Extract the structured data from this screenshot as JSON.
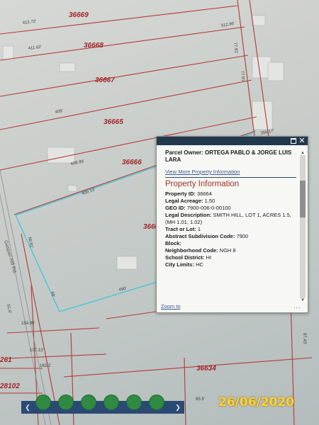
{
  "map": {
    "parcel_labels": [
      "36669",
      "36668",
      "36667",
      "36665",
      "36666",
      "3666",
      "36634",
      "28102",
      "261"
    ],
    "dimension_labels": [
      "412.72'",
      "411.62'",
      "408'",
      "408.99'",
      "400.13'",
      "312.96'",
      "77.91'",
      "77.91'",
      "356.17'",
      "60.81'",
      "154.95'",
      "107.13'",
      "163.1'",
      "68'",
      "490'",
      "87.43'",
      "65.5'",
      "51.0'"
    ],
    "road_label": "Gaspari Hill Rd."
  },
  "popup": {
    "owner": "Parcel Owner: ORTEGA PABLO & JORGE LUIS LARA",
    "view_more": "View More Property Information",
    "section_title": "Property Information",
    "fields": {
      "property_id": {
        "label": "Property ID:",
        "value": "36664"
      },
      "legal_acreage": {
        "label": "Legal Acreage:",
        "value": "1.50"
      },
      "geo_id": {
        "label": "GEO ID:",
        "value": "7900-006-0-00100"
      },
      "legal_description": {
        "label": "Legal Description:",
        "value": "SMITH HILL, LOT 1, ACRES 1.5, (MH 1.01, 1.02)"
      },
      "tract": {
        "label": "Tract or Lot:",
        "value": "1"
      },
      "abstract_code": {
        "label": "Abstract Subdivision Code:",
        "value": "7900"
      },
      "block": {
        "label": "Block:",
        "value": ""
      },
      "neighborhood": {
        "label": "Neighborhood Code:",
        "value": "NGH 8"
      },
      "school_district": {
        "label": "School District:",
        "value": "HI"
      },
      "city_limits": {
        "label": "City Limits:",
        "value": "HC"
      }
    },
    "zoom_to": "Zoom to",
    "more": "..."
  },
  "toolbar": {
    "prev_icon": "chevron-left-icon",
    "next_icon": "chevron-right-icon",
    "buttons": [
      "layers-icon",
      "draw-icon",
      "measure-icon",
      "print-icon",
      "basemap-icon",
      "share-icon"
    ],
    "button_color": "#2f8a43"
  },
  "timestamp": "26/06/2020",
  "colors": {
    "parcel_line": "#b33a3a",
    "selected_parcel": "#3fc8d8",
    "popup_header": "#22394d",
    "section_title": "#a0332c",
    "timestamp": "#ffd232"
  }
}
